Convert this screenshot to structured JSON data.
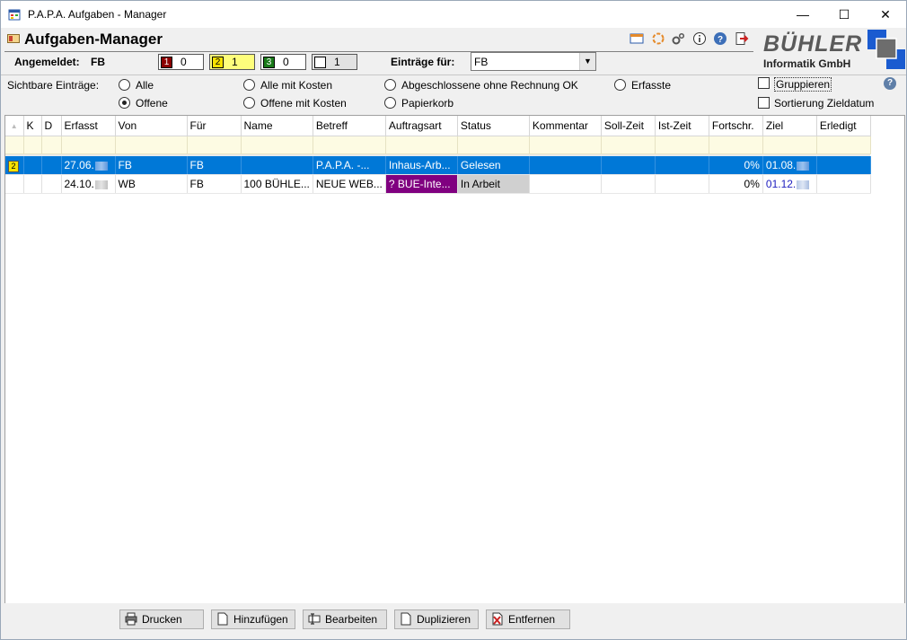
{
  "window": {
    "title": "P.A.P.A. Aufgaben - Manager",
    "minimize": "—",
    "maximize": "☐",
    "close": "✕"
  },
  "header": {
    "app_title": "Aufgaben-Manager",
    "logo_name": "BÜHLER",
    "logo_sub": "Informatik GmbH",
    "logged_in_label": "Angemeldet:",
    "logged_in_user": "FB",
    "counters": [
      {
        "badge": "1",
        "count": "0",
        "color": "#8b0000"
      },
      {
        "badge": "2",
        "count": "1",
        "color": "#f7e200"
      },
      {
        "badge": "3",
        "count": "0",
        "color": "#1a7a1a"
      },
      {
        "badge": "",
        "count": "1",
        "color": "#ffffff"
      }
    ],
    "entries_for_label": "Einträge für:",
    "entries_for_value": "FB",
    "toolbar_icons": [
      "window-icon",
      "refresh-icon",
      "settings-icon",
      "info-icon",
      "help-icon",
      "exit-icon"
    ]
  },
  "filter": {
    "label": "Sichtbare Einträge:",
    "options": [
      "Alle",
      "Offene",
      "Alle mit Kosten",
      "Offene mit Kosten",
      "Abgeschlossene ohne Rechnung OK",
      "Papierkorb",
      "Erfasste"
    ],
    "selected": "Offene",
    "checkboxes": [
      "Gruppieren",
      "Sortierung Zieldatum"
    ]
  },
  "table": {
    "columns": [
      "",
      "K",
      "D",
      "Erfasst",
      "Von",
      "Für",
      "Name",
      "Betreff",
      "Auftragsart",
      "Status",
      "Kommentar",
      "Soll-Zeit",
      "Ist-Zeit",
      "Fortschr.",
      "Ziel",
      "Erledigt"
    ],
    "rows": [
      {
        "pri": "2",
        "k": "",
        "d": "",
        "erfasst": "27.06.",
        "von": "FB",
        "fuer": "FB",
        "name": "",
        "betreff": "P.A.P.A.  -...",
        "auftragsart": "Inhaus-Arb...",
        "status": "Gelesen",
        "kommentar": "",
        "soll": "",
        "ist": "",
        "fortschritt": "0%",
        "ziel": "01.08.",
        "erledigt": ""
      },
      {
        "pri": "",
        "k": "",
        "d": "",
        "erfasst": "24.10.",
        "von": "WB",
        "fuer": "FB",
        "name": "100 BÜHLE...",
        "betreff": "NEUE WEB...",
        "auftragsart": "?  BUE-Inte...",
        "status": "In Arbeit",
        "kommentar": "",
        "soll": "",
        "ist": "",
        "fortschritt": "0%",
        "ziel": "01.12.",
        "erledigt": ""
      }
    ]
  },
  "footer": {
    "buttons": [
      "Drucken",
      "Hinzufügen",
      "Bearbeiten",
      "Duplizieren",
      "Entfernen"
    ]
  },
  "colors": {
    "selection": "#0078d7",
    "auftragsart_purple": "#800080",
    "status_grey": "#d0d0d0",
    "filter_row": "#fdfbe3"
  }
}
